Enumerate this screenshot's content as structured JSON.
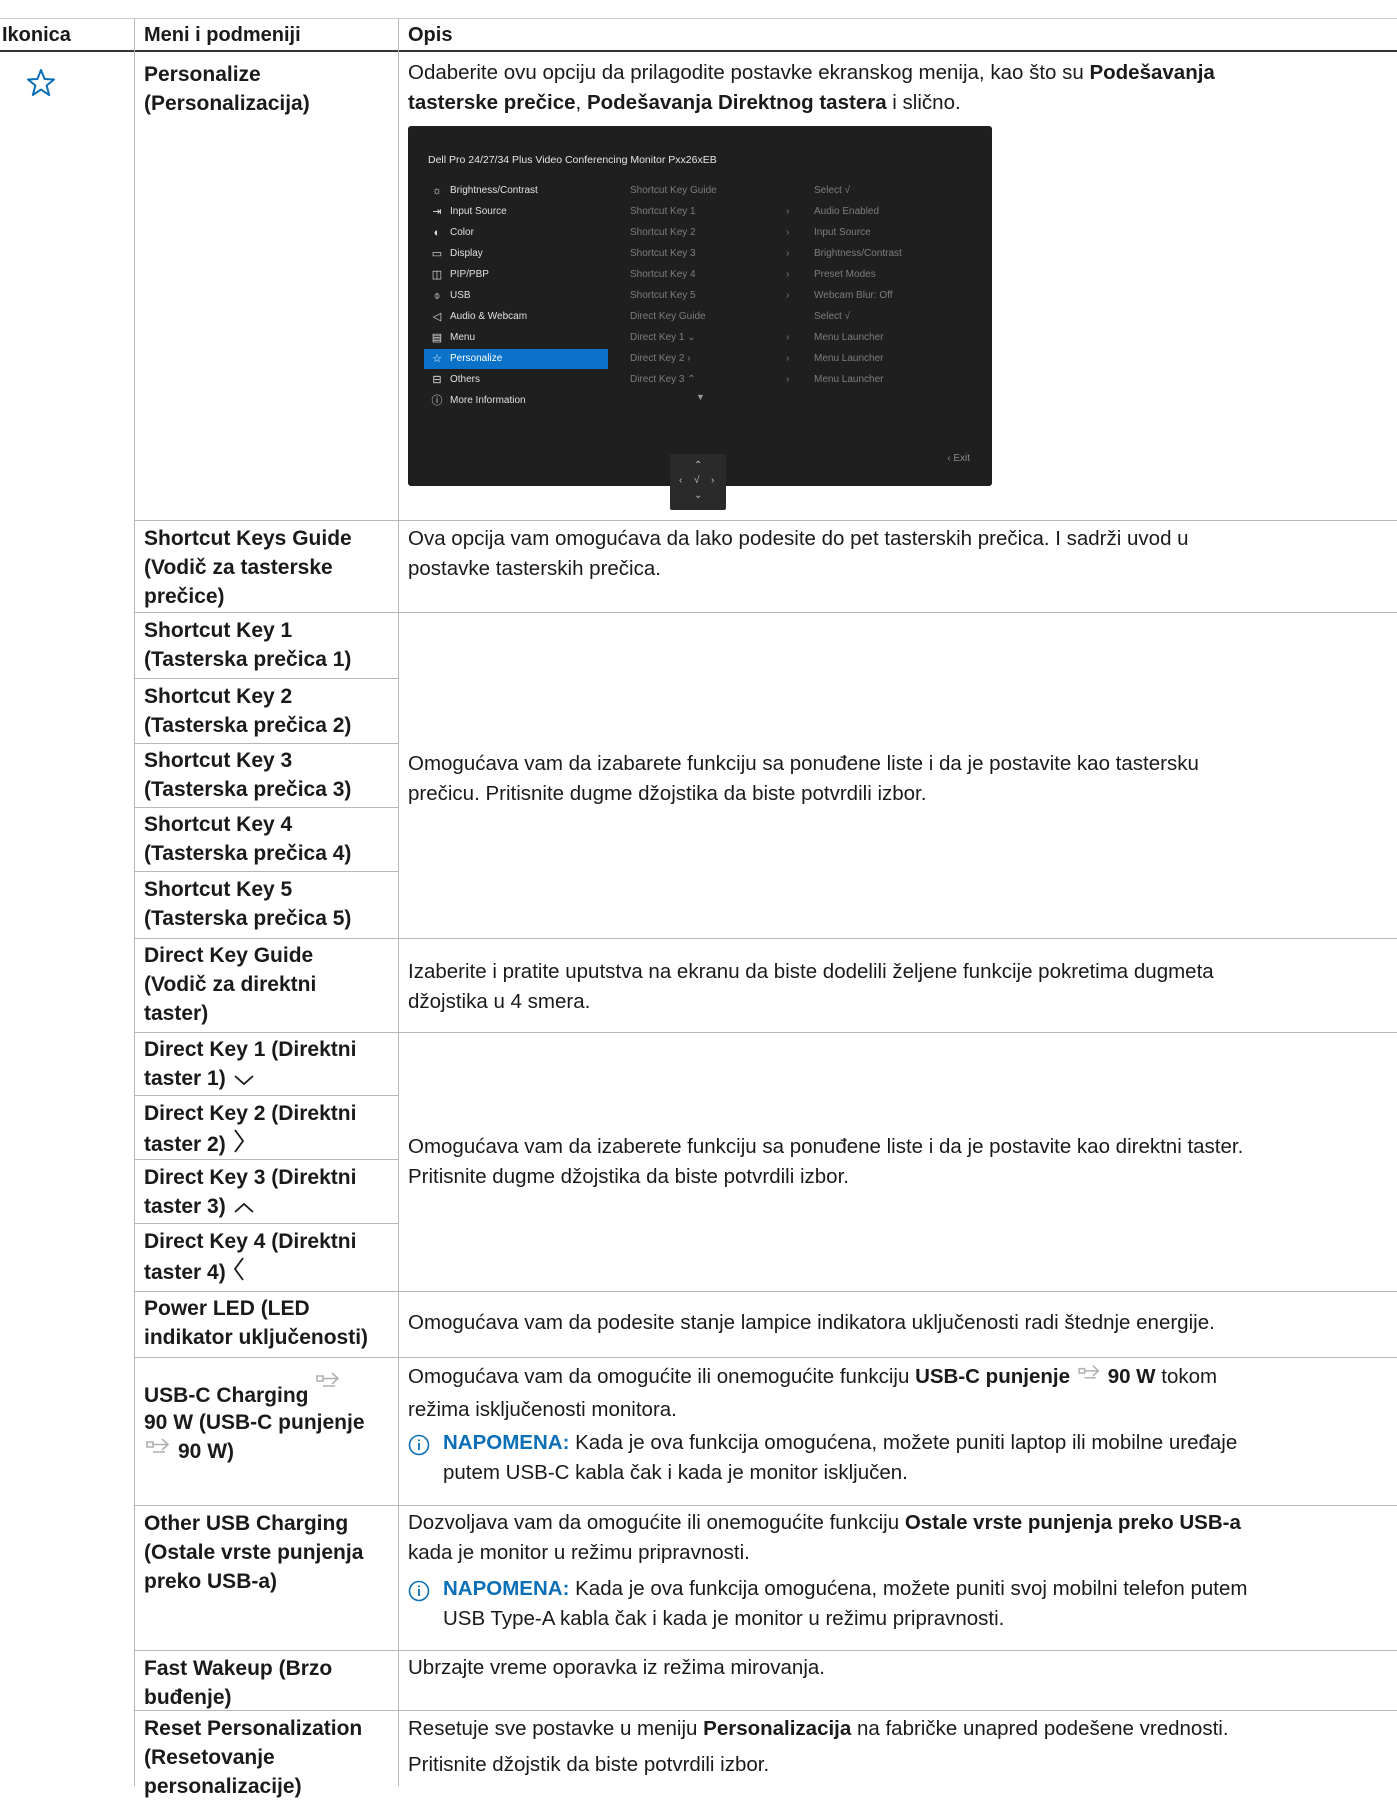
{
  "header": {
    "col_icon": "Ikonica",
    "col_menu": "Meni i podmeniji",
    "col_desc": "Opis"
  },
  "icons": {
    "row_icon": "star-outline-icon",
    "accent": "#0b6fb8"
  },
  "rows": {
    "personalize": {
      "menu_line1": "Personalize",
      "menu_line2": "(Personalizacija)",
      "desc_p1": "Odaberite ovu opciju da prilagodite postavke ekranskog menija, kao što su ",
      "desc_b1": "Podešavanja",
      "desc_b2": "tasterske prečice",
      "desc_p2": ", ",
      "desc_b3": "Podešavanja Direktnog tastera",
      "desc_p3": " i slično."
    },
    "shortcut_guide": {
      "menu_line1": "Shortcut Keys Guide",
      "menu_line2": "(Vodič za tasterske",
      "menu_line3": "prečice)",
      "desc_line1": "Ova opcija vam omogućava da lako podesite do pet tasterskih prečica. I sadrži uvod u",
      "desc_line2": "postavke tasterskih prečica."
    },
    "shortcut_keys": [
      {
        "line1": "Shortcut Key 1",
        "line2": "(Tasterska prečica 1)"
      },
      {
        "line1": "Shortcut Key 2",
        "line2": "(Tasterska prečica 2)"
      },
      {
        "line1": "Shortcut Key 3",
        "line2": "(Tasterska prečica 3)"
      },
      {
        "line1": "Shortcut Key 4",
        "line2": "(Tasterska prečica 4)"
      },
      {
        "line1": "Shortcut Key 5",
        "line2": "(Tasterska prečica 5)"
      }
    ],
    "shortcut_keys_desc": {
      "line1": "Omogućava vam da izabarete funkciju sa ponuđene liste i da je postavite kao tastersku",
      "line2": "prečicu. Pritisnite dugme džojstika da biste potvrdili izbor."
    },
    "direct_guide": {
      "menu_line1": "Direct Key Guide",
      "menu_line2": "(Vodič za direktni",
      "menu_line3": "taster)",
      "desc_line1": "Izaberite i pratite uputstva na ekranu da biste dodelili željene funkcije pokretima dugmeta",
      "desc_line2": "džojstika u 4 smera."
    },
    "direct_keys": [
      {
        "line1": "Direct Key 1 (Direktni",
        "line2": "taster 1)",
        "icon": "chevron-down-icon"
      },
      {
        "line1": "Direct Key 2 (Direktni",
        "line2": "taster 2)",
        "icon": "chevron-right-icon"
      },
      {
        "line1": "Direct Key 3 (Direktni",
        "line2": "taster 3)",
        "icon": "chevron-up-icon"
      },
      {
        "line1": "Direct Key 4 (Direktni",
        "line2": "taster 4)",
        "icon": "chevron-left-icon"
      }
    ],
    "direct_keys_desc": {
      "line1": "Omogućava vam da izaberete funkciju sa ponuđene liste i da je postavite kao direktni taster.",
      "line2": "Pritisnite dugme džojstika da biste potvrdili izbor."
    },
    "power_led": {
      "menu_line1": "Power LED (LED",
      "menu_line2": "indikator uključenosti)",
      "desc": "Omogućava vam da podesite stanje lampice indikatora uključenosti radi štednje energije."
    },
    "usbc": {
      "menu_line1": "USB-C Charging",
      "menu_line2": "90 W (USB-C punjenje",
      "menu_line3": "90 W)",
      "desc_p1": "Omogućava vam da omogućite ili onemogućite funkciju ",
      "desc_b1": "USB-C punjenje",
      "desc_b2": "90 W",
      "desc_p2": " tokom",
      "desc_line2": "režima isključenosti monitora.",
      "note_label": "NAPOMENA:",
      "note_line1": " Kada je ova funkcija omogućena, možete puniti laptop ili mobilne uređaje",
      "note_line2": "putem USB-C kabla čak i kada je monitor isključen."
    },
    "other_usb": {
      "menu_line1": "Other USB Charging",
      "menu_line2": "(Ostale vrste punjenja",
      "menu_line3": "preko USB-a)",
      "desc_p1": "Dozvoljava vam da omogućite ili onemogućite funkciju ",
      "desc_b1": "Ostale vrste punjenja preko USB-a",
      "desc_line2": "kada je monitor u režimu pripravnosti.",
      "note_label": "NAPOMENA:",
      "note_line1": " Kada je ova funkcija omogućena, možete puniti svoj mobilni telefon putem",
      "note_line2": "USB Type-A kabla čak i kada je monitor u režimu pripravnosti."
    },
    "fast_wakeup": {
      "menu_line1": "Fast Wakeup (Brzo",
      "menu_line2": "buđenje)",
      "desc": "Ubrzajte vreme oporavka iz režima mirovanja."
    },
    "reset": {
      "menu_line1": "Reset Personalization",
      "menu_line2": "(Resetovanje",
      "menu_line3": "personalizacije)",
      "desc_p1": "Resetuje sve postavke u meniju ",
      "desc_b1": "Personalizacija",
      "desc_p2": " na fabričke unapred podešene vrednosti.",
      "desc_line2": "Pritisnite džojstik da biste potvrdili izbor."
    }
  },
  "osd": {
    "title": "Dell Pro 24/27/34 Plus Video Conferencing Monitor Pxx26xEB",
    "menu": [
      {
        "icon": "brightness-icon",
        "glyph": "☼",
        "label": "Brightness/Contrast"
      },
      {
        "icon": "input-source-icon",
        "glyph": "⇥",
        "label": "Input Source"
      },
      {
        "icon": "color-icon",
        "glyph": "◐",
        "label": "Color"
      },
      {
        "icon": "display-icon",
        "glyph": "▭",
        "label": "Display"
      },
      {
        "icon": "pip-icon",
        "glyph": "◫",
        "label": "PIP/PBP"
      },
      {
        "icon": "usb-icon",
        "glyph": "⌽",
        "label": "USB"
      },
      {
        "icon": "audio-icon",
        "glyph": "◁",
        "label": "Audio & Webcam"
      },
      {
        "icon": "menu-icon",
        "glyph": "▤",
        "label": "Menu"
      },
      {
        "icon": "star-icon",
        "glyph": "☆",
        "label": "Personalize"
      },
      {
        "icon": "others-icon",
        "glyph": "⊟",
        "label": "Others"
      },
      {
        "icon": "info-icon",
        "glyph": "ⓘ",
        "label": "More Information"
      }
    ],
    "selected_index": 8,
    "middle": [
      "Shortcut Key Guide",
      "Shortcut Key 1",
      "Shortcut Key 2",
      "Shortcut Key 3",
      "Shortcut Key 4",
      "Shortcut Key 5",
      "Direct Key Guide",
      "Direct Key 1 ⌄",
      "Direct Key 2 ›",
      "Direct Key 3 ⌃"
    ],
    "right": [
      "Select √",
      "Audio Enabled",
      "Input Source",
      "Brightness/Contrast",
      "Preset Modes",
      "Webcam Blur: Off",
      "Select √",
      "Menu Launcher",
      "Menu Launcher",
      "Menu Launcher"
    ],
    "exit_label": "‹ Exit"
  }
}
